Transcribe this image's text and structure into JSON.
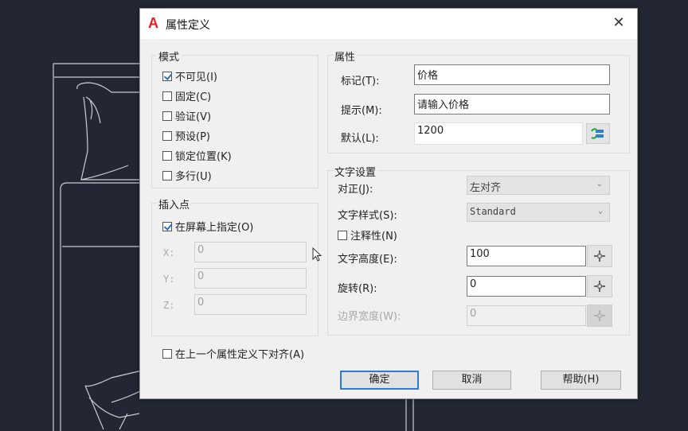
{
  "dialog": {
    "title": "属性定义",
    "app_icon": "autocad-logo-icon",
    "close_label": "✕"
  },
  "mode": {
    "label": "模式",
    "options": [
      {
        "label": "不可见(I)",
        "checked": true
      },
      {
        "label": "固定(C)",
        "checked": false
      },
      {
        "label": "验证(V)",
        "checked": false
      },
      {
        "label": "预设(P)",
        "checked": false
      },
      {
        "label": "锁定位置(K)",
        "checked": false
      },
      {
        "label": "多行(U)",
        "checked": false
      }
    ]
  },
  "insertion_point": {
    "label": "插入点",
    "specify_on_screen": {
      "label": "在屏幕上指定(O)",
      "checked": true
    },
    "x": {
      "label": "X:",
      "value": "0"
    },
    "y": {
      "label": "Y:",
      "value": "0"
    },
    "z": {
      "label": "Z:",
      "value": "0"
    }
  },
  "attribute": {
    "label": "属性",
    "tag": {
      "label": "标记(T):",
      "value": "价格"
    },
    "prompt": {
      "label": "提示(M):",
      "value": "请输入价格"
    },
    "default": {
      "label": "默认(L):",
      "value": "1200",
      "button_icon": "insert-field-icon"
    }
  },
  "text_settings": {
    "label": "文字设置",
    "justification": {
      "label": "对正(J):",
      "value": "左对齐"
    },
    "text_style": {
      "label": "文字样式(S):",
      "value": "Standard"
    },
    "annotative": {
      "label": "注释性(N)",
      "checked": false
    },
    "text_height": {
      "label": "文字高度(E):",
      "value": "100"
    },
    "rotation": {
      "label": "旋转(R):",
      "value": "0"
    },
    "boundary_width": {
      "label": "边界宽度(W):",
      "value": "0"
    },
    "pick_icon": "pick-point-icon"
  },
  "align_below": {
    "label": "在上一个属性定义下对齐(A)",
    "checked": false
  },
  "buttons": {
    "ok": "确定",
    "cancel": "取消",
    "help": "帮助(H)"
  }
}
